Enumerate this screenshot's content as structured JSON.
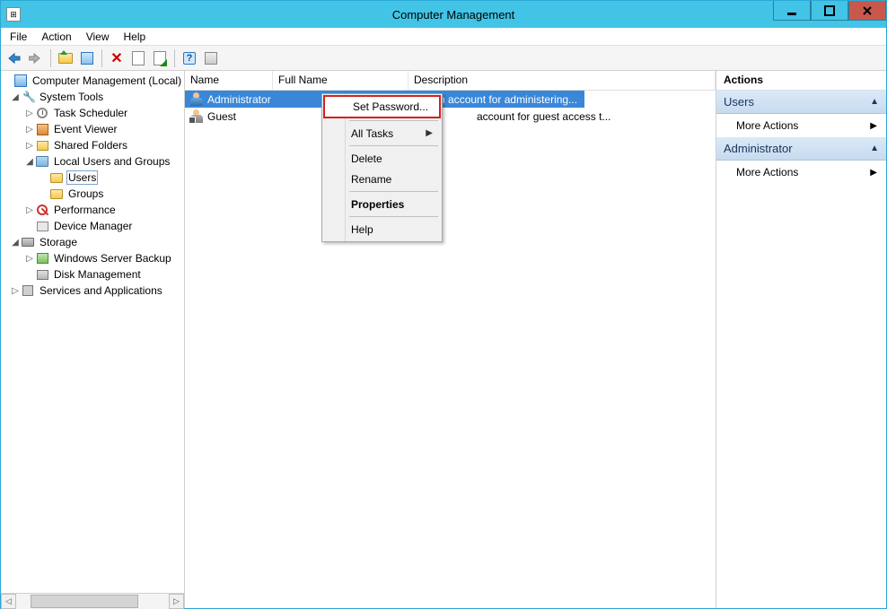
{
  "window": {
    "title": "Computer Management"
  },
  "menu": {
    "file": "File",
    "action": "Action",
    "view": "View",
    "help": "Help"
  },
  "tree": {
    "root": "Computer Management (Local)",
    "systools": "System Tools",
    "task": "Task Scheduler",
    "event": "Event Viewer",
    "shared": "Shared Folders",
    "lug": "Local Users and Groups",
    "users": "Users",
    "groups": "Groups",
    "perf": "Performance",
    "devmgr": "Device Manager",
    "storage": "Storage",
    "wsb": "Windows Server Backup",
    "diskmgmt": "Disk Management",
    "svcapp": "Services and Applications"
  },
  "list": {
    "columns": {
      "name": "Name",
      "fullname": "Full Name",
      "description": "Description"
    },
    "rows": [
      {
        "name": "Administrator",
        "fullname": "",
        "description": "Built-in account for administering..."
      },
      {
        "name": "Guest",
        "fullname": "",
        "description": "account for guest access t..."
      }
    ]
  },
  "context_menu": {
    "set_password": "Set Password...",
    "all_tasks": "All Tasks",
    "delete": "Delete",
    "rename": "Rename",
    "properties": "Properties",
    "help": "Help"
  },
  "actions": {
    "header": "Actions",
    "users_section": "Users",
    "admin_section": "Administrator",
    "more_actions": "More Actions"
  }
}
